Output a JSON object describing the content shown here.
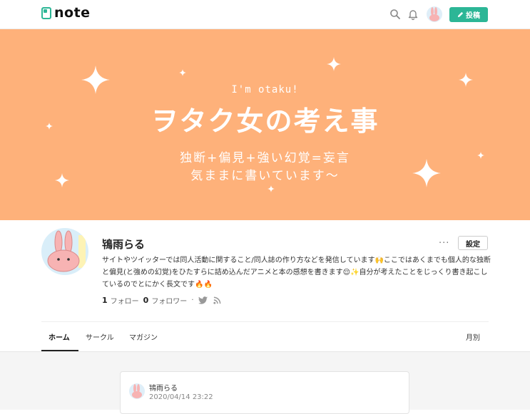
{
  "header": {
    "logo_text": "note",
    "post_button": "投稿",
    "icons": [
      "search-icon",
      "bell-icon",
      "avatar",
      "pencil-icon"
    ]
  },
  "banner": {
    "subtitle": "I'm otaku!",
    "title": "ヲタク女の考え事",
    "line1": "独断+偏見+強い幻覚=妄言",
    "line2": "気ままに書いています〜",
    "background": "#feb17a"
  },
  "profile": {
    "name": "鴇雨らる",
    "more": "···",
    "settings_button": "設定",
    "bio": "サイトやツイッターでは同人活動に関すること/同人誌の作り方などを発信しています🙌ここではあくまでも個人的な独断と偏見(と強めの幻覚)をひたすらに詰め込んだアニメと本の感想を書きます😌✨自分が考えたことをじっくり書き起こしているのでとにかく長文です🔥🔥",
    "follow_count": "1",
    "follow_label": "フォロー",
    "follower_count": "0",
    "follower_label": "フォロワー",
    "separator": "·"
  },
  "tabs": {
    "items": [
      "ホーム",
      "サークル",
      "マガジン"
    ],
    "active": "ホーム",
    "monthly": "月別"
  },
  "card": {
    "author": "鴇雨らる",
    "date": "2020/04/14 23:22"
  },
  "colors": {
    "accent": "#2cb696",
    "banner": "#feb17a"
  }
}
